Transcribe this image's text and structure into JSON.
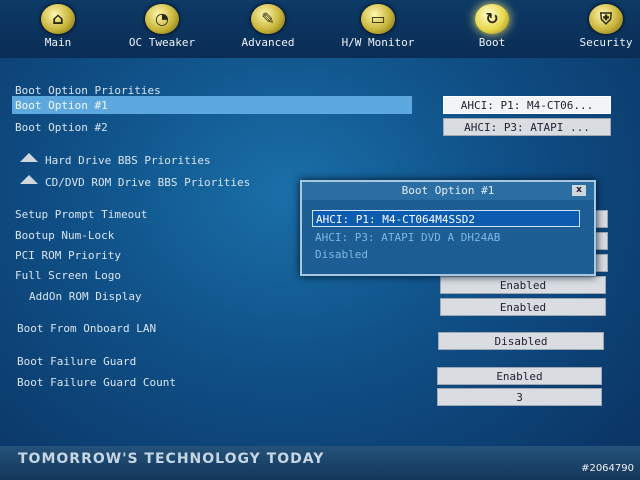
{
  "nav": [
    {
      "label": "Main",
      "icon": "home-icon",
      "glyph": "⌂"
    },
    {
      "label": "OC Tweaker",
      "icon": "gauge-icon",
      "glyph": "◔"
    },
    {
      "label": "Advanced",
      "icon": "wrench-icon",
      "glyph": "✎"
    },
    {
      "label": "H/W Monitor",
      "icon": "monitor-icon",
      "glyph": "▭"
    },
    {
      "label": "Boot",
      "icon": "refresh-icon",
      "glyph": "↻"
    },
    {
      "label": "Security",
      "icon": "shield-icon",
      "glyph": "⛨"
    }
  ],
  "active_tab": "Boot",
  "boot": {
    "section_title": "Boot Option Priorities",
    "option1_label": "Boot Option #1",
    "option1_value": "AHCI: P1: M4-CT06...",
    "option2_label": "Boot Option #2",
    "option2_value": "AHCI: P3: ATAPI  ...",
    "hdd_bbs": "Hard Drive BBS Priorities",
    "cdrom_bbs": "CD/DVD ROM Drive BBS Priorities",
    "setup_prompt_timeout": "Setup Prompt Timeout",
    "bootup_numlock": "Bootup Num-Lock",
    "pci_rom_priority": "PCI ROM Priority",
    "full_screen_logo": "Full Screen Logo",
    "addon_rom_display": "AddOn ROM Display",
    "addon_rom_value": "Enabled",
    "full_screen_logo_value": "Enabled",
    "boot_onboard_lan": "Boot From Onboard LAN",
    "boot_onboard_lan_value": "Disabled",
    "boot_failure_guard": "Boot Failure Guard",
    "boot_failure_guard_value": "Enabled",
    "boot_failure_guard_count": "Boot Failure Guard Count",
    "boot_failure_guard_count_value": "3"
  },
  "popup": {
    "title": "Boot Option #1",
    "close": "x",
    "options": [
      "AHCI: P1: M4-CT064M4SSD2",
      "AHCI: P3: ATAPI   DVD A   DH24AB",
      "Disabled"
    ],
    "selected_index": 0
  },
  "footer": {
    "slogan": "TOMORROW'S TECHNOLOGY TODAY"
  },
  "watermark": "#2064790",
  "colors": {
    "accent": "#5ea8e0",
    "background": "#0f4f86",
    "selected_option": "#0b5bb0"
  }
}
